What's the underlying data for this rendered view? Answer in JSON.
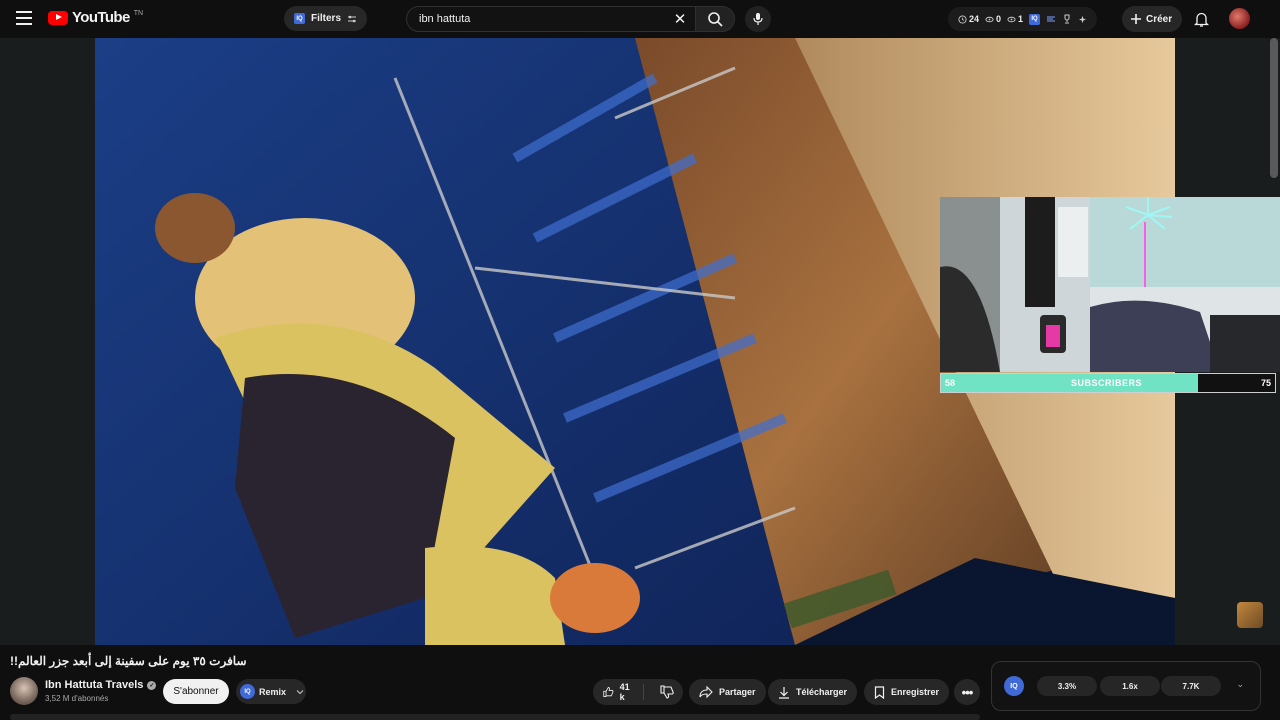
{
  "header": {
    "logo_text": "YouTube",
    "logo_sup": "TN",
    "filters_label": "Filters",
    "filters_badge": "IQ",
    "search_value": "ibn hattuta",
    "stats": {
      "history": "24",
      "views": "0",
      "watched": "1"
    },
    "stats_badge": "IQ",
    "create_label": "Créer"
  },
  "overlay": {
    "sub_current": "58",
    "sub_label": "SUBSCRIBERS",
    "sub_goal": "75",
    "sub_progress": 0.77
  },
  "video": {
    "title": "!!سافرت ٣٥ يوم على سفينة إلى أبعد جزر العالم",
    "channel_name": "Ibn Hattuta Travels",
    "channel_subs": "3,52 M d'abonnés",
    "subscribe_label": "S'abonner",
    "remix_label": "Remix",
    "remix_badge": "IQ",
    "like_count": "41 k",
    "share_label": "Partager",
    "download_label": "Télécharger",
    "save_label": "Enregistrer"
  },
  "stats_panel": {
    "badge": "IQ",
    "engagement": "3.3%",
    "multiplier": "1.6x",
    "count": "7.7K"
  },
  "colors": {
    "brand_red": "#ff0000",
    "iq_blue": "#3f6ad8",
    "sub_bar": "#6fe3c3"
  }
}
